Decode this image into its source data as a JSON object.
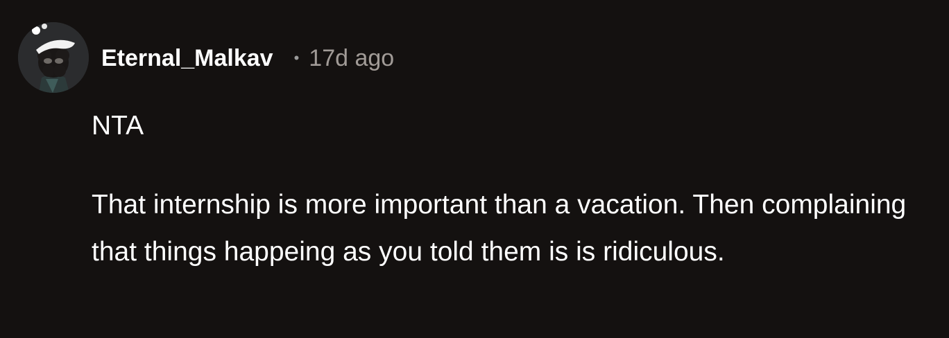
{
  "comment": {
    "author": "Eternal_Malkav",
    "separator": "•",
    "time_ago": "17d ago",
    "paragraphs": [
      "NTA",
      "That internship is more important than a vacation. Then complaining that things happeing as you told them is is ridiculous."
    ]
  },
  "colors": {
    "background": "#141110",
    "text": "#ffffff",
    "meta_text": "#a19b97",
    "avatar_bg": "#2b2c2e"
  }
}
